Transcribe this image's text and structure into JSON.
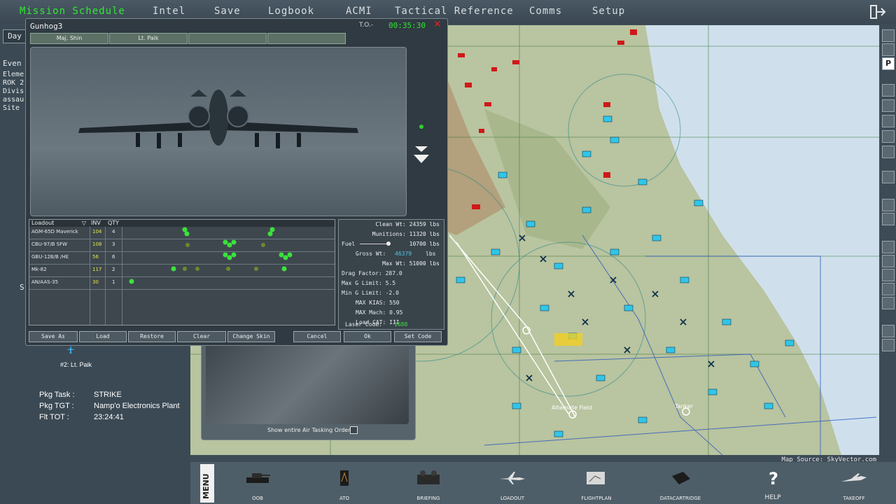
{
  "top_menu": {
    "mission_schedule": "Mission Schedule",
    "intel": "Intel",
    "save": "Save",
    "logbook": "Logbook",
    "acmi": "ACMI",
    "tactical_reference": "Tactical Reference",
    "comms": "Comms",
    "setup": "Setup"
  },
  "left_panel": {
    "day_tab": "Day",
    "events_title": "Even",
    "event_lines": [
      "Eleme",
      "ROK 2",
      "Divis",
      "assau",
      "Site"
    ],
    "pilot2": "#2: Lt. Paik",
    "pkg_task_label": "Pkg Task :",
    "pkg_task_value": "STRIKE",
    "pkg_tgt_label": "Pkg TGT   :",
    "pkg_tgt_value": "Namp'o Electronics Plant",
    "flt_tot_label": "Flt TOT   :",
    "flt_tot_value": "23:24:41",
    "s_letter": "S"
  },
  "dialog": {
    "title": "Gunhog3",
    "to_label": "T.O.-",
    "clock": "00:35:30",
    "pilots": [
      "Maj. Shin",
      "Lt. Paik",
      "",
      ""
    ],
    "loadout_header": "Loadout",
    "inv_header": "INV",
    "qty_header": "QTY",
    "weapons": [
      {
        "name": "AGM-65D Maverick",
        "inv": "104",
        "qty": "4"
      },
      {
        "name": "CBU-97/B SFW",
        "inv": "108",
        "qty": "3"
      },
      {
        "name": "GBU-12B/B /HE",
        "inv": "56",
        "qty": "6"
      },
      {
        "name": "Mk-82",
        "inv": "117",
        "qty": "2"
      },
      {
        "name": "AN/AAS-35",
        "inv": "30",
        "qty": "1"
      }
    ],
    "stats": {
      "clean_wt": "Clean Wt: 24359 lbs",
      "munitions": "Munitions: 11320 lbs",
      "fuel_label": "Fuel",
      "fuel": "10700 lbs",
      "gross_label": "Gross Wt:",
      "gross_value": "46379",
      "lbs": "lbs",
      "max_wt": "Max Wt: 51000 lbs",
      "drag": "Drag Factor: 287.0",
      "max_g": "Max G Limit: 5.5",
      "min_g": "Min G Limit: -2.0",
      "max_kias": "MAX KIAS: 550",
      "max_mach": "MAX Mach: 0.95",
      "load_cat": "Load CAT: III",
      "laser_label": "Laser Code:",
      "laser_value": "1688"
    },
    "buttons": {
      "save_as": "Save As",
      "load": "Load",
      "restore": "Restore",
      "clear": "Clear",
      "change_skin": "Change Skin",
      "cancel": "Cancel",
      "ok": "Ok",
      "set_code": "Set Code"
    }
  },
  "ato_panel": {
    "show_ato": "Show entire Air Tasking Order"
  },
  "map": {
    "source": "Map Source: SkyVector.com",
    "alternate_field": "Alternate Field",
    "tanker": "Tanker"
  },
  "bottom_nav": {
    "menu": "MENU",
    "items": [
      "OOB",
      "ATO",
      "BRIEFING",
      "LOADOUT",
      "FLIGHTPLAN",
      "DATACARTRIDGE",
      "HELP",
      "TAKEOFF"
    ]
  },
  "colors": {
    "accent_green": "#32e832",
    "friendly": "#2fc6e8",
    "enemy": "#d01818"
  }
}
